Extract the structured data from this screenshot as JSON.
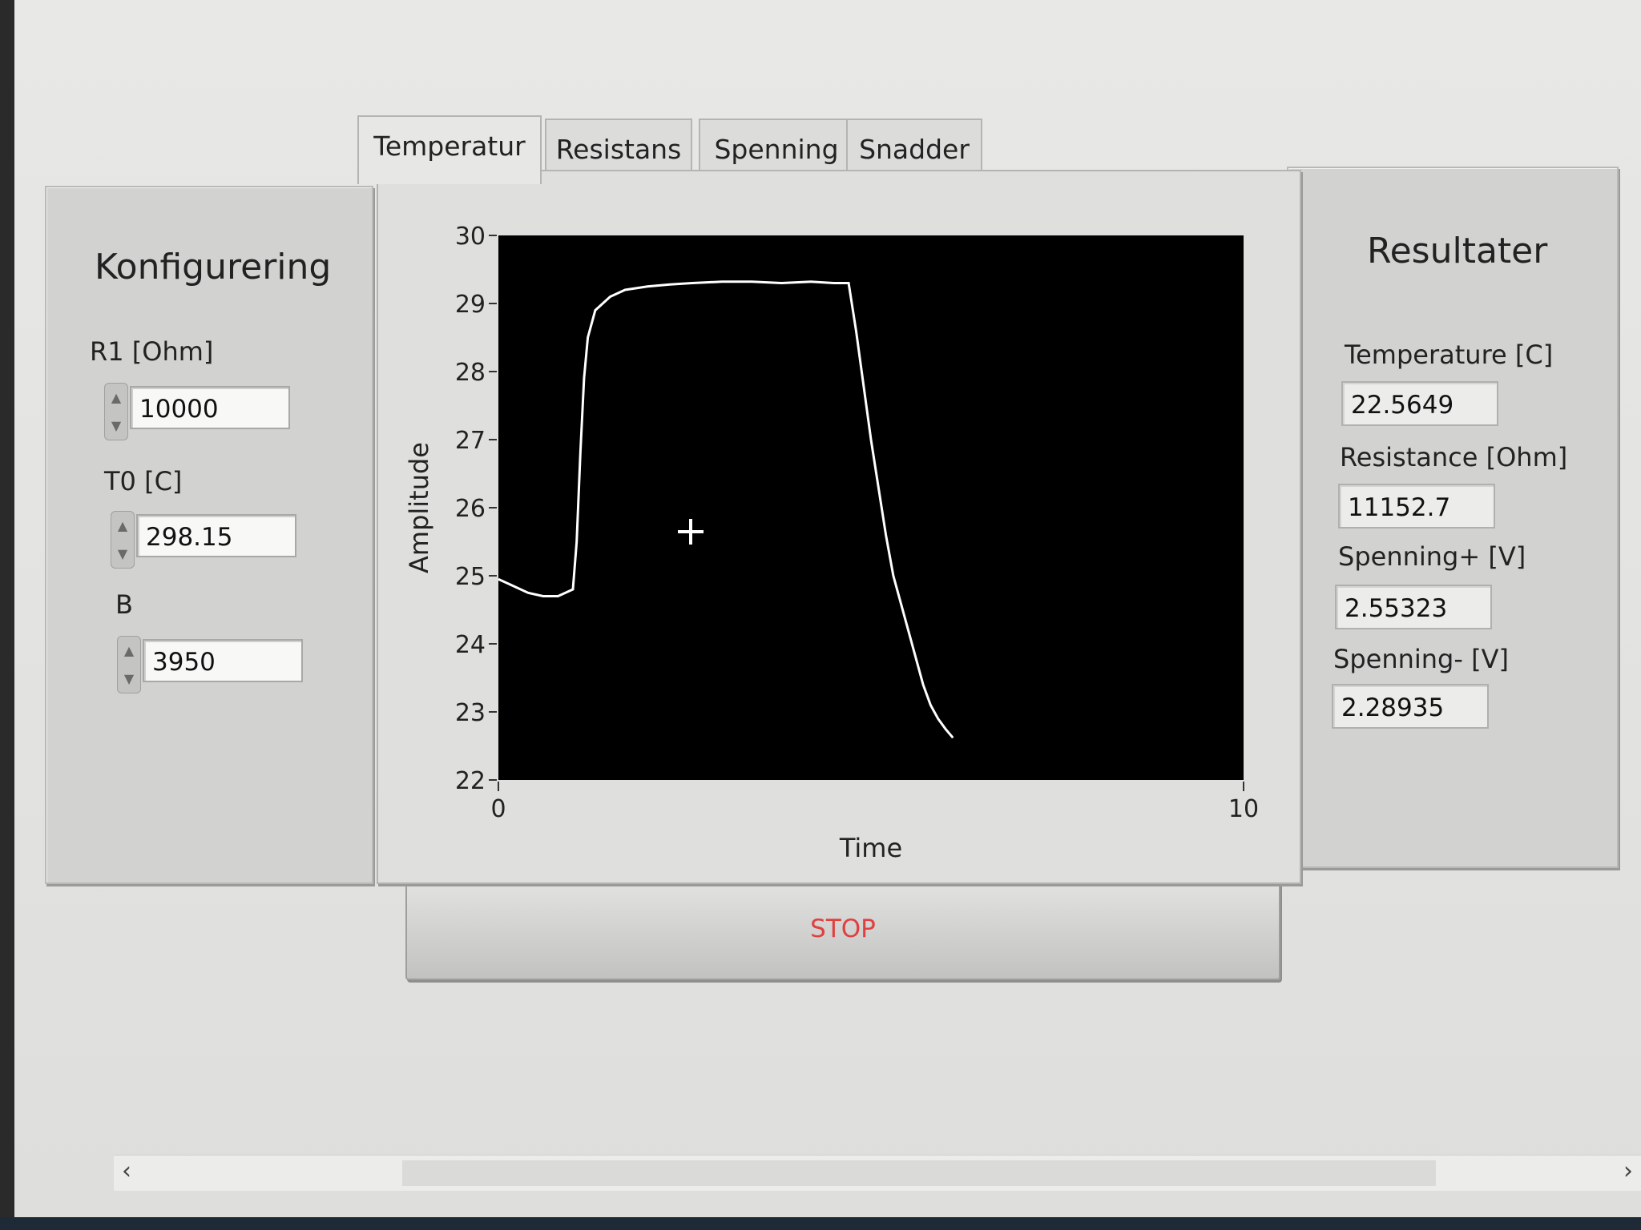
{
  "config": {
    "title": "Konfigurering",
    "r1_label": "R1 [Ohm]",
    "r1_value": "10000",
    "t0_label": "T0 [C]",
    "t0_value": "298.15",
    "b_label": "B",
    "b_value": "3950"
  },
  "tabs": [
    {
      "label": "Temperatur",
      "active": true
    },
    {
      "label": "Resistans",
      "active": false
    },
    {
      "label": "Spenning",
      "active": false
    },
    {
      "label": "Snadder",
      "active": false
    }
  ],
  "chart_data": {
    "type": "line",
    "xlabel": "Time",
    "ylabel": "Amplitude",
    "xlim": [
      0,
      10
    ],
    "ylim": [
      22,
      30
    ],
    "yticks": [
      22,
      23,
      24,
      25,
      26,
      27,
      28,
      29,
      30
    ],
    "xticks": [
      0,
      10
    ],
    "grid": false,
    "background": "#000000",
    "line_color": "#ffffff",
    "series": [
      {
        "x": [
          0,
          0.2,
          0.4,
          0.6,
          0.8,
          1.0,
          1.05,
          1.1,
          1.15,
          1.2,
          1.3,
          1.5,
          1.7,
          2.0,
          2.3,
          2.6,
          3.0,
          3.4,
          3.8,
          4.2,
          4.5,
          4.7,
          4.8,
          4.9,
          5.0,
          5.1,
          5.2,
          5.3,
          5.4,
          5.5,
          5.6,
          5.7,
          5.8,
          5.9,
          6.0,
          6.1
        ],
        "y": [
          24.95,
          24.85,
          24.75,
          24.7,
          24.7,
          24.8,
          25.5,
          26.8,
          27.9,
          28.5,
          28.9,
          29.1,
          29.2,
          29.25,
          29.28,
          29.3,
          29.32,
          29.32,
          29.3,
          29.32,
          29.3,
          29.3,
          28.6,
          27.8,
          27.0,
          26.3,
          25.6,
          25.0,
          24.6,
          24.2,
          23.8,
          23.4,
          23.1,
          22.9,
          22.75,
          22.62
        ]
      }
    ]
  },
  "stop_label": "STOP",
  "results": {
    "title": "Resultater",
    "items": [
      {
        "label": "Temperature [C]",
        "value": "22.5649"
      },
      {
        "label": "Resistance [Ohm]",
        "value": "11152.7"
      },
      {
        "label": "Spenning+ [V]",
        "value": "2.55323"
      },
      {
        "label": "Spenning- [V]",
        "value": "2.28935"
      }
    ]
  },
  "icons": {
    "spinner_up": "▲",
    "spinner_down": "▼",
    "scroll_left": "‹",
    "scroll_right": "›",
    "cursor": "crosshair-icon"
  }
}
